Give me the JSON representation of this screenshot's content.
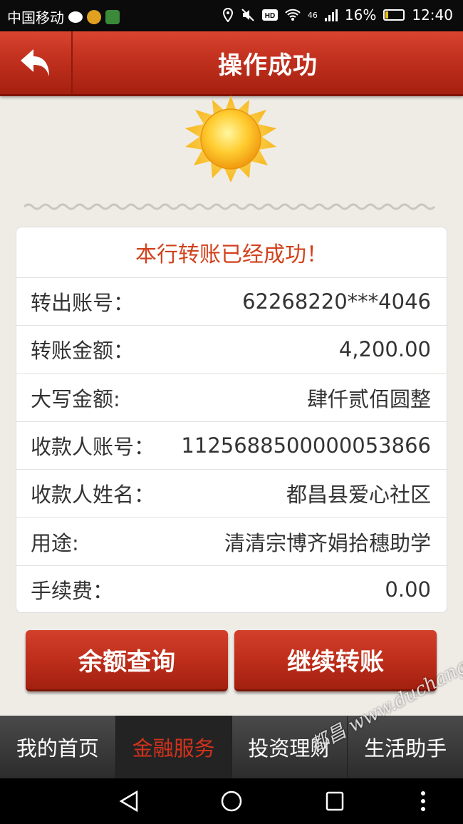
{
  "status_bar": {
    "carrier": "中国移动",
    "network": "46",
    "battery": "16%",
    "time": "12:40",
    "icons": [
      "chat-icon",
      "weibo-icon",
      "app-icon",
      "location-icon",
      "mute-icon",
      "hd-icon",
      "wifi-icon",
      "signal-icon",
      "battery-icon"
    ]
  },
  "header": {
    "title": "操作成功",
    "back_icon": "back-arrow-icon"
  },
  "result": {
    "message": "本行转账已经成功！",
    "rows": [
      {
        "label": "转出账号：",
        "value": "62268220***4046"
      },
      {
        "label": "转账金额：",
        "value": "4,200.00"
      },
      {
        "label": "大写金额:",
        "value": "肆仟贰佰圆整"
      },
      {
        "label": "收款人账号：",
        "value": "1125688500000053866"
      },
      {
        "label": "收款人姓名：",
        "value": "都昌县爱心社区"
      },
      {
        "label": "用途:",
        "value": "清清宗博齐娟拾穗助学"
      },
      {
        "label": "手续费：",
        "value": "0.00"
      }
    ]
  },
  "actions": {
    "balance_query": "余额查询",
    "continue_transfer": "继续转账"
  },
  "tabs": [
    {
      "label": "我的首页",
      "active": false
    },
    {
      "label": "金融服务",
      "active": true
    },
    {
      "label": "投资理财",
      "active": false
    },
    {
      "label": "生活助手",
      "active": false
    }
  ],
  "watermark": "都昌 www.duchang.org",
  "colors": {
    "header_red": "#c1301e",
    "accent_text": "#d2421d",
    "background": "#efece6",
    "active_tab_text": "#d2321c"
  }
}
